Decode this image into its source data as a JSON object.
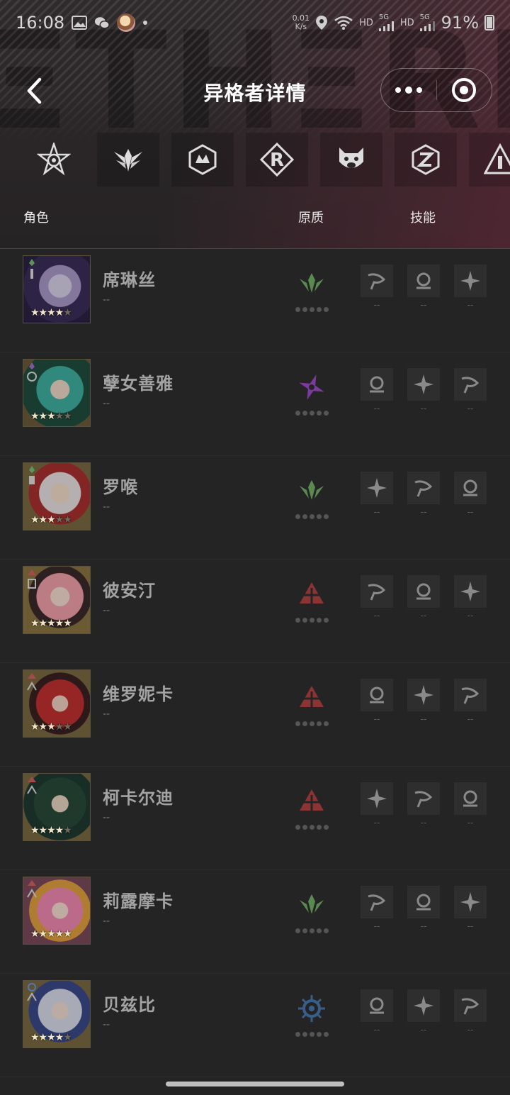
{
  "status_bar": {
    "time": "16:08",
    "net_speed_value": "0.01",
    "net_speed_unit": "K/s",
    "hd1": "HD",
    "sig1": "5G",
    "hd2": "HD",
    "sig2": "5G",
    "battery": "91%"
  },
  "nav": {
    "title": "异格者详情"
  },
  "factions": [
    {
      "icon": "faction-star-emblem-icon"
    },
    {
      "icon": "faction-winged-crest-icon"
    },
    {
      "icon": "faction-hex-crown-icon"
    },
    {
      "icon": "faction-r-diamond-icon"
    },
    {
      "icon": "faction-boar-mask-icon"
    },
    {
      "icon": "faction-z-hexagon-icon"
    },
    {
      "icon": "faction-triangle-i-icon"
    }
  ],
  "columns": {
    "role": "角色",
    "quality": "原质",
    "skills": "技能"
  },
  "characters": [
    {
      "name": "席琳丝",
      "sub": "--",
      "stars": 4,
      "quality_type": "green",
      "skill_levels": [
        "--",
        "--",
        "--"
      ]
    },
    {
      "name": "孽女善雅",
      "sub": "--",
      "stars": 3,
      "quality_type": "purple",
      "skill_levels": [
        "--",
        "--",
        "--"
      ]
    },
    {
      "name": "罗喉",
      "sub": "--",
      "stars": 3,
      "quality_type": "green",
      "skill_levels": [
        "--",
        "--",
        "--"
      ]
    },
    {
      "name": "彼安汀",
      "sub": "--",
      "stars": 5,
      "quality_type": "red",
      "skill_levels": [
        "--",
        "--",
        "--"
      ]
    },
    {
      "name": "维罗妮卡",
      "sub": "--",
      "stars": 3,
      "quality_type": "red",
      "skill_levels": [
        "--",
        "--",
        "--"
      ]
    },
    {
      "name": "柯卡尔迪",
      "sub": "--",
      "stars": 4,
      "quality_type": "red",
      "skill_levels": [
        "--",
        "--",
        "--"
      ]
    },
    {
      "name": "莉露摩卡",
      "sub": "--",
      "stars": 5,
      "quality_type": "green",
      "skill_levels": [
        "--",
        "--",
        "--"
      ]
    },
    {
      "name": "贝兹比",
      "sub": "--",
      "stars": 4,
      "quality_type": "blue",
      "skill_levels": [
        "--",
        "--",
        "--"
      ]
    }
  ],
  "colors": {
    "quality_green": "#5a8a52",
    "quality_purple": "#7a3aa0",
    "quality_red": "#8a3434",
    "quality_blue": "#3a5e8a"
  }
}
